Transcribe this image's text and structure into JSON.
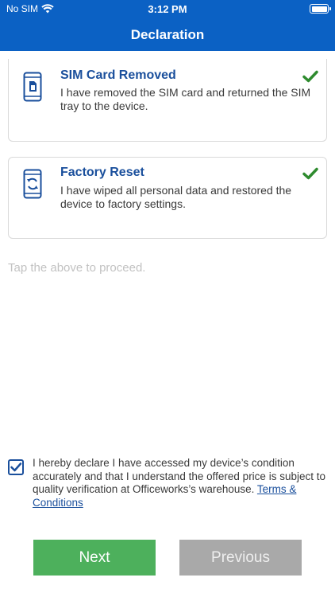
{
  "status_bar": {
    "carrier": "No SIM",
    "time": "3:12 PM",
    "wifi_icon": "wifi-icon",
    "battery_icon": "battery-icon"
  },
  "header": {
    "title": "Declaration",
    "background": "#0b61c4"
  },
  "cards": [
    {
      "icon": "phone-sim-icon",
      "title": "SIM Card Removed",
      "description": "I have removed the SIM card and returned the SIM tray to the device.",
      "checked": true
    },
    {
      "icon": "phone-reset-icon",
      "title": "Factory Reset",
      "description": "I have wiped all personal data and restored the device to factory settings.",
      "checked": true
    }
  ],
  "hint": "Tap the above to proceed.",
  "declaration": {
    "checked": true,
    "text": "I hereby declare I have accessed my device’s condition accurately and that I understand the offered price is subject to quality verification at Officeworks’s warehouse.",
    "link_text": "Terms & Conditions"
  },
  "buttons": {
    "next": "Next",
    "previous": "Previous"
  },
  "colors": {
    "primary": "#0b61c4",
    "title": "#1a4f9c",
    "check": "#2e8b2e",
    "next": "#4db05c",
    "previous": "#a9a9a9"
  }
}
